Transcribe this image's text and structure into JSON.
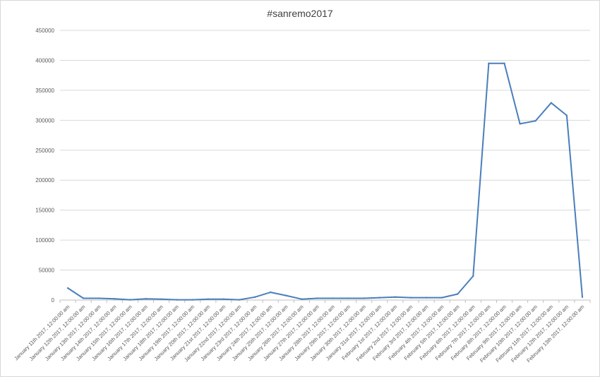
{
  "chart_data": {
    "type": "line",
    "title": "#sanremo2017",
    "xlabel": "",
    "ylabel": "",
    "ylim": [
      0,
      450000
    ],
    "y_ticks": [
      "0",
      "50000",
      "100000",
      "150000",
      "200000",
      "250000",
      "300000",
      "350000",
      "400000",
      "450000"
    ],
    "grid": "horizontal",
    "legend": "none",
    "series_color": "#4a7ebb",
    "categories": [
      "January 11th 2017, 12:00:00 am",
      "January 12th 2017, 12:00:00 am",
      "January 13th 2017, 12:00:00 am",
      "January 14th 2017, 12:00:00 am",
      "January 15th 2017, 12:00:00 am",
      "January 16th 2017, 12:00:00 am",
      "January 17th 2017, 12:00:00 am",
      "January 18th 2017, 12:00:00 am",
      "January 19th 2017, 12:00:00 am",
      "January 20th 2017, 12:00:00 am",
      "January 21st 2017, 12:00:00 am",
      "January 22nd 2017, 12:00:00 am",
      "January 23rd 2017, 12:00:00 am",
      "January 24th 2017, 12:00:00 am",
      "January 25th 2017, 12:00:00 am",
      "January 26th 2017, 12:00:00 am",
      "January 27th 2017, 12:00:00 am",
      "January 28th 2017, 12:00:00 am",
      "January 29th 2017, 12:00:00 am",
      "January 30th 2017, 12:00:00 am",
      "January 31st 2017, 12:00:00 am",
      "February 1st 2017, 12:00:00 am",
      "February 2nd 2017, 12:00:00 am",
      "February 3rd 2017, 12:00:00 am",
      "February 4th 2017, 12:00:00 am",
      "February 5th 2017, 12:00:00 am",
      "February 6th 2017, 12:00:00 am",
      "February 7th 2017, 12:00:00 am",
      "February 8th 2017, 12:00:00 am",
      "February 9th 2017, 12:00:00 am",
      "February 10th 2017, 12:00:00 am",
      "February 11th 2017, 12:00:00 am",
      "February 12th 2017, 12:00:00 am",
      "February 13th 2017, 12:00:00 am"
    ],
    "values": [
      20000,
      3000,
      3000,
      2000,
      500,
      2000,
      1500,
      500,
      500,
      1500,
      1500,
      500,
      5000,
      13000,
      7500,
      1500,
      3000,
      3000,
      3000,
      3000,
      4000,
      5000,
      4000,
      4000,
      4000,
      10000,
      40000,
      395000,
      395000,
      294000,
      299000,
      329000,
      308000,
      5000
    ]
  }
}
